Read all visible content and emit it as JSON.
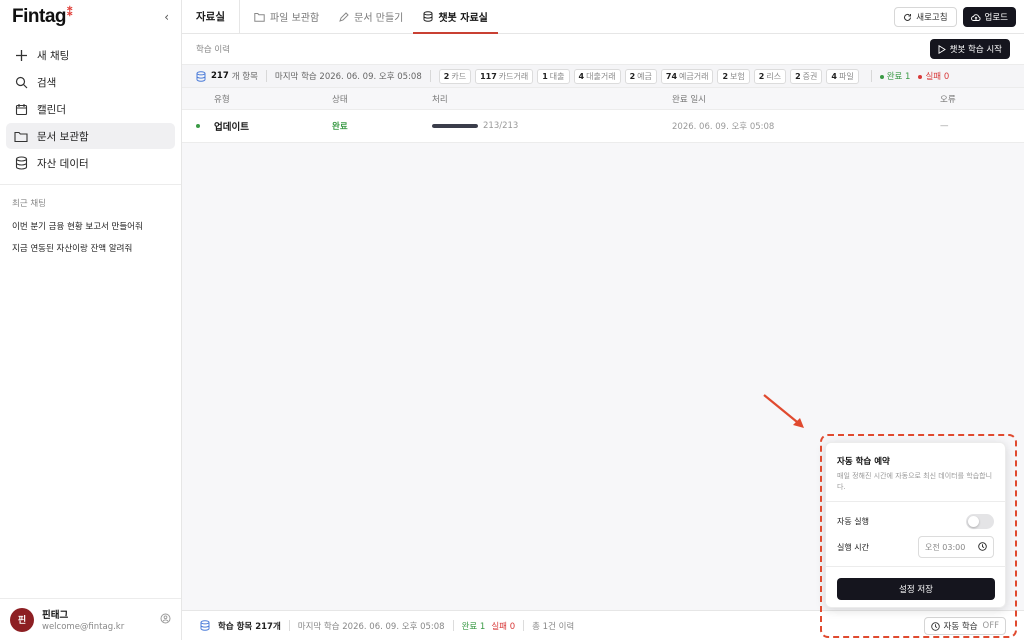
{
  "sidebar": {
    "logo": "Fintag",
    "nav": [
      {
        "label": "새 채팅",
        "icon": "plus-icon"
      },
      {
        "label": "검색",
        "icon": "search-icon"
      },
      {
        "label": "캘린더",
        "icon": "calendar-icon"
      },
      {
        "label": "문서 보관함",
        "icon": "folder-icon",
        "active": true
      },
      {
        "label": "자산 데이터",
        "icon": "database-icon"
      }
    ],
    "recent_title": "최근 채팅",
    "recent": [
      "이번 분기 금융 현황 보고서 만들어줘",
      "지금 연동된 자산이랑 잔액 알려줘"
    ],
    "profile": {
      "avatar_text": "핀",
      "name": "핀태그",
      "email": "welcome@fintag.kr"
    }
  },
  "topbar": {
    "title": "자료실",
    "tabs": [
      {
        "label": "파일 보관함",
        "icon": "folder-icon"
      },
      {
        "label": "문서 만들기",
        "icon": "pencil-icon"
      },
      {
        "label": "챗봇 자료실",
        "icon": "database-icon",
        "active": true
      }
    ],
    "refresh_label": "새로고침",
    "upload_label": "업로드"
  },
  "subhead": {
    "label": "학습 이력",
    "start_label": "챗봇 학습 시작"
  },
  "stats": {
    "total": "217",
    "total_unit": "개 항목",
    "last_trained": "마지막 학습 2026. 06. 09. 오후 05:08",
    "chips": [
      {
        "count": "2",
        "label": "카드"
      },
      {
        "count": "117",
        "label": "카드거래"
      },
      {
        "count": "1",
        "label": "대출"
      },
      {
        "count": "4",
        "label": "대출거래"
      },
      {
        "count": "2",
        "label": "예금"
      },
      {
        "count": "74",
        "label": "예금거래"
      },
      {
        "count": "2",
        "label": "보험"
      },
      {
        "count": "2",
        "label": "리스"
      },
      {
        "count": "2",
        "label": "증권"
      },
      {
        "count": "4",
        "label": "파일"
      }
    ],
    "success": "완료 1",
    "failure": "실패 0"
  },
  "table": {
    "headers": [
      "유형",
      "상태",
      "처리",
      "완료 일시",
      "오류"
    ],
    "rows": [
      {
        "type": "업데이트",
        "status": "완료",
        "progress_text": "213/213",
        "progress": 1.0,
        "completed_at": "2026. 06. 09. 오후 05:08",
        "error": "—"
      }
    ]
  },
  "footer": {
    "items_label": "학습 항목 217개",
    "last_trained": "마지막 학습 2026. 06. 09. 오후 05:08",
    "success": "완료 1",
    "failure": "실패 0",
    "history": "총 1건 이력",
    "auto_label": "자동 학습",
    "auto_state": "OFF"
  },
  "popover": {
    "title": "자동 학습 예약",
    "description": "매일 정해진 시간에 자동으로 최신 데이터를 학습합니다.",
    "auto_run_label": "자동 실행",
    "auto_run_on": false,
    "time_label": "실행 시간",
    "time_value": "오전 03:00",
    "save_label": "설정 저장"
  },
  "colors": {
    "brand": "#e0403a",
    "accent_tab": "#c94033",
    "primary_button": "#15151e",
    "success": "#3a9a45",
    "failure": "#d83a3a",
    "annotation": "#e04a2f"
  }
}
